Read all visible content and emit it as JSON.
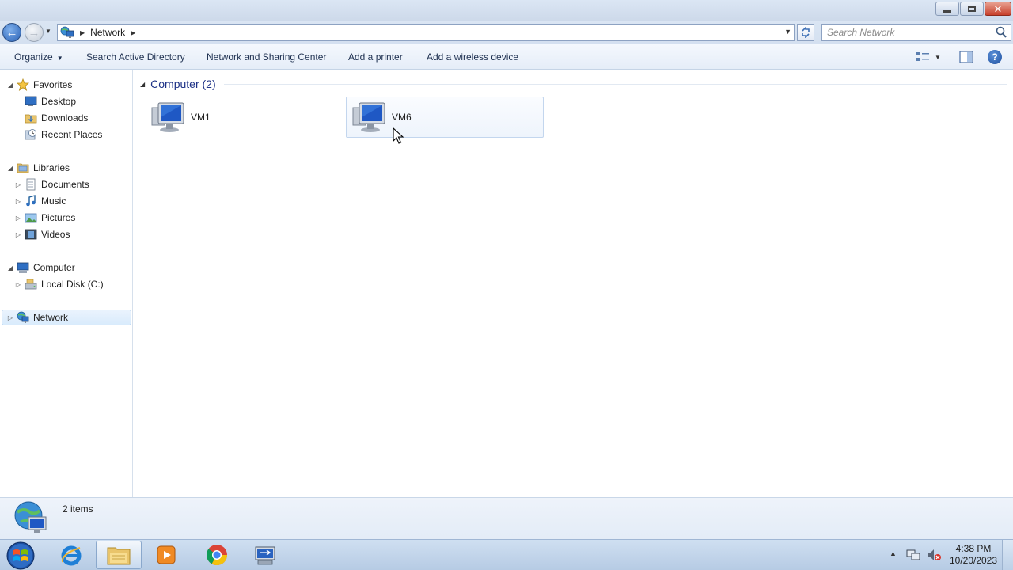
{
  "window": {
    "minimize_icon": "minimize-icon",
    "maximize_icon": "restore-icon",
    "close_glyph": "✕"
  },
  "nav": {
    "back_glyph": "←",
    "forward_glyph": "→",
    "address": {
      "crumbs": [
        "Network"
      ]
    },
    "search": {
      "placeholder": "Search Network"
    }
  },
  "commands": {
    "organize": "Organize",
    "search_ad": "Search Active Directory",
    "network_sharing": "Network and Sharing Center",
    "add_printer": "Add a printer",
    "add_wireless": "Add a wireless device",
    "help_glyph": "?"
  },
  "sidebar": {
    "favorites": {
      "label": "Favorites",
      "items": [
        {
          "label": "Desktop",
          "icon": "desktop-icon"
        },
        {
          "label": "Downloads",
          "icon": "downloads-folder-icon"
        },
        {
          "label": "Recent Places",
          "icon": "recent-places-icon"
        }
      ]
    },
    "libraries": {
      "label": "Libraries",
      "items": [
        {
          "label": "Documents",
          "icon": "documents-icon"
        },
        {
          "label": "Music",
          "icon": "music-icon"
        },
        {
          "label": "Pictures",
          "icon": "pictures-icon"
        },
        {
          "label": "Videos",
          "icon": "videos-icon"
        }
      ]
    },
    "computer": {
      "label": "Computer",
      "items": [
        {
          "label": "Local Disk (C:)",
          "icon": "local-disk-icon"
        }
      ]
    },
    "network": {
      "label": "Network",
      "selected": true
    }
  },
  "content": {
    "group": {
      "title": "Computer (2)",
      "items": [
        {
          "label": "VM1",
          "icon": "network-computer-icon"
        },
        {
          "label": "VM6",
          "icon": "network-computer-icon",
          "hovered": true
        }
      ]
    }
  },
  "details": {
    "count": "2 items"
  },
  "taskbar": {
    "apps": [
      {
        "name": "Internet Explorer",
        "icon": "internet-explorer-icon"
      },
      {
        "name": "Windows Explorer",
        "icon": "windows-explorer-icon",
        "active": true
      },
      {
        "name": "Windows Media Player",
        "icon": "media-player-icon"
      },
      {
        "name": "Google Chrome",
        "icon": "chrome-icon"
      },
      {
        "name": "Remote Desktop Connection",
        "icon": "remote-desktop-icon"
      }
    ],
    "clock": {
      "time": "4:38 PM",
      "date": "10/20/2023"
    }
  }
}
